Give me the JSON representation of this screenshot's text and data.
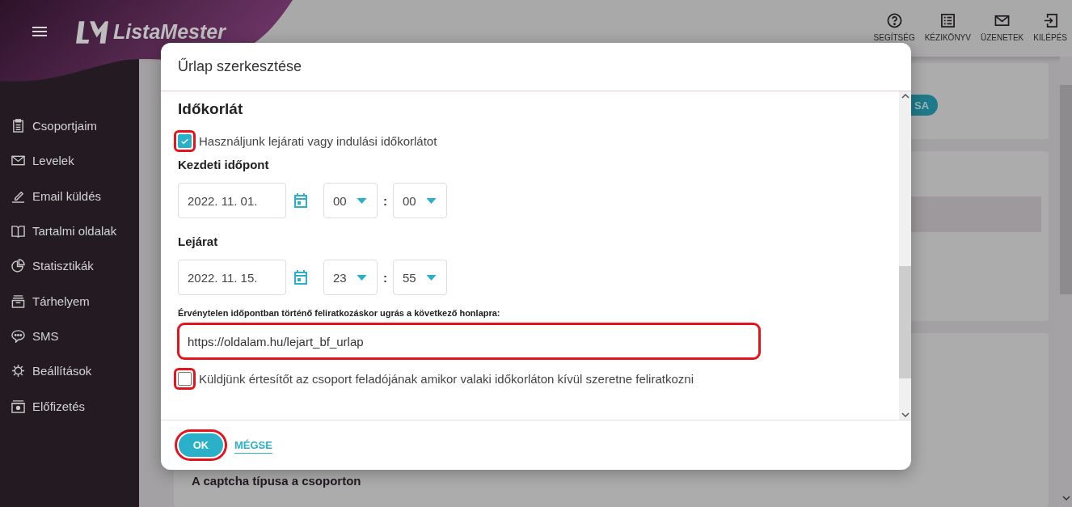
{
  "app": {
    "logo": "ListaMester"
  },
  "top_nav": [
    {
      "label": "SEGÍTSÉG"
    },
    {
      "label": "KÉZIKÖNYV"
    },
    {
      "label": "ÜZENETEK"
    },
    {
      "label": "KILÉPÉS"
    }
  ],
  "sidebar": {
    "items": [
      {
        "label": "Csoportjaim"
      },
      {
        "label": "Levelek"
      },
      {
        "label": "Email küldés"
      },
      {
        "label": "Tartalmi oldalak"
      },
      {
        "label": "Statisztikák"
      },
      {
        "label": "Tárhelyem"
      },
      {
        "label": "SMS"
      },
      {
        "label": "Beállítások"
      },
      {
        "label": "Előfizetés"
      }
    ]
  },
  "background": {
    "button_fragment": "SA",
    "section_title": "A captcha típusa a csoporton"
  },
  "dialog": {
    "title": "Űrlap szerkesztése",
    "section_title": "Időkorlát",
    "use_limit": {
      "label": "Használjunk lejárati vagy indulási időkorlátot",
      "checked": true,
      "highlighted": true
    },
    "times": [
      {
        "label": "Kezdeti időpont",
        "date": "2022. 11. 01.",
        "hour": "00",
        "separator": ":",
        "minute": "00"
      },
      {
        "label": "Lejárat",
        "date": "2022. 11. 15.",
        "hour": "23",
        "separator": ":",
        "minute": "55"
      }
    ],
    "redirect": {
      "label": "Érvénytelen időpontban történő feliratkozáskor ugrás a következő honlapra:",
      "value": "https://oldalam.hu/lejart_bf_urlap",
      "highlighted": true
    },
    "notify": {
      "label": "Küldjünk értesítőt az csoport feladójának amikor valaki időkorláton kívül szeretne feliratkozni",
      "checked": false,
      "highlighted": true
    },
    "ok": {
      "label": "OK",
      "highlighted": true
    },
    "cancel": {
      "label": "MÉGSE"
    }
  }
}
